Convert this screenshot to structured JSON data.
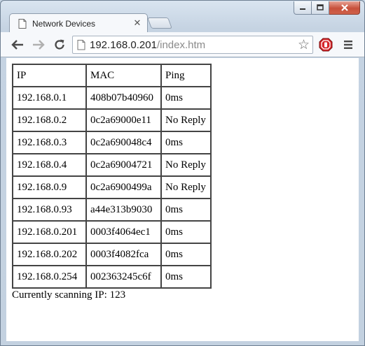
{
  "browser": {
    "tab_title": "Network Devices",
    "url_host": "192.168.0.201",
    "url_path": "/index.htm"
  },
  "table": {
    "headers": [
      "IP",
      "MAC",
      "Ping"
    ],
    "rows": [
      [
        "192.168.0.1",
        "408b07b40960",
        "0ms"
      ],
      [
        "192.168.0.2",
        "0c2a69000e11",
        "No Reply"
      ],
      [
        "192.168.0.3",
        "0c2a690048c4",
        "0ms"
      ],
      [
        "192.168.0.4",
        "0c2a69004721",
        "No Reply"
      ],
      [
        "192.168.0.9",
        "0c2a6900499a",
        "No Reply"
      ],
      [
        "192.168.0.93",
        "a44e313b9030",
        "0ms"
      ],
      [
        "192.168.0.201",
        "0003f4064ec1",
        "0ms"
      ],
      [
        "192.168.0.202",
        "0003f4082fca",
        "0ms"
      ],
      [
        "192.168.0.254",
        "002363245c6f",
        "0ms"
      ]
    ]
  },
  "status_text": "Currently scanning IP: 123",
  "colors": {
    "frame": "#c5d3e2",
    "close_button": "#c7503b",
    "extension_red": "#d7262a"
  }
}
